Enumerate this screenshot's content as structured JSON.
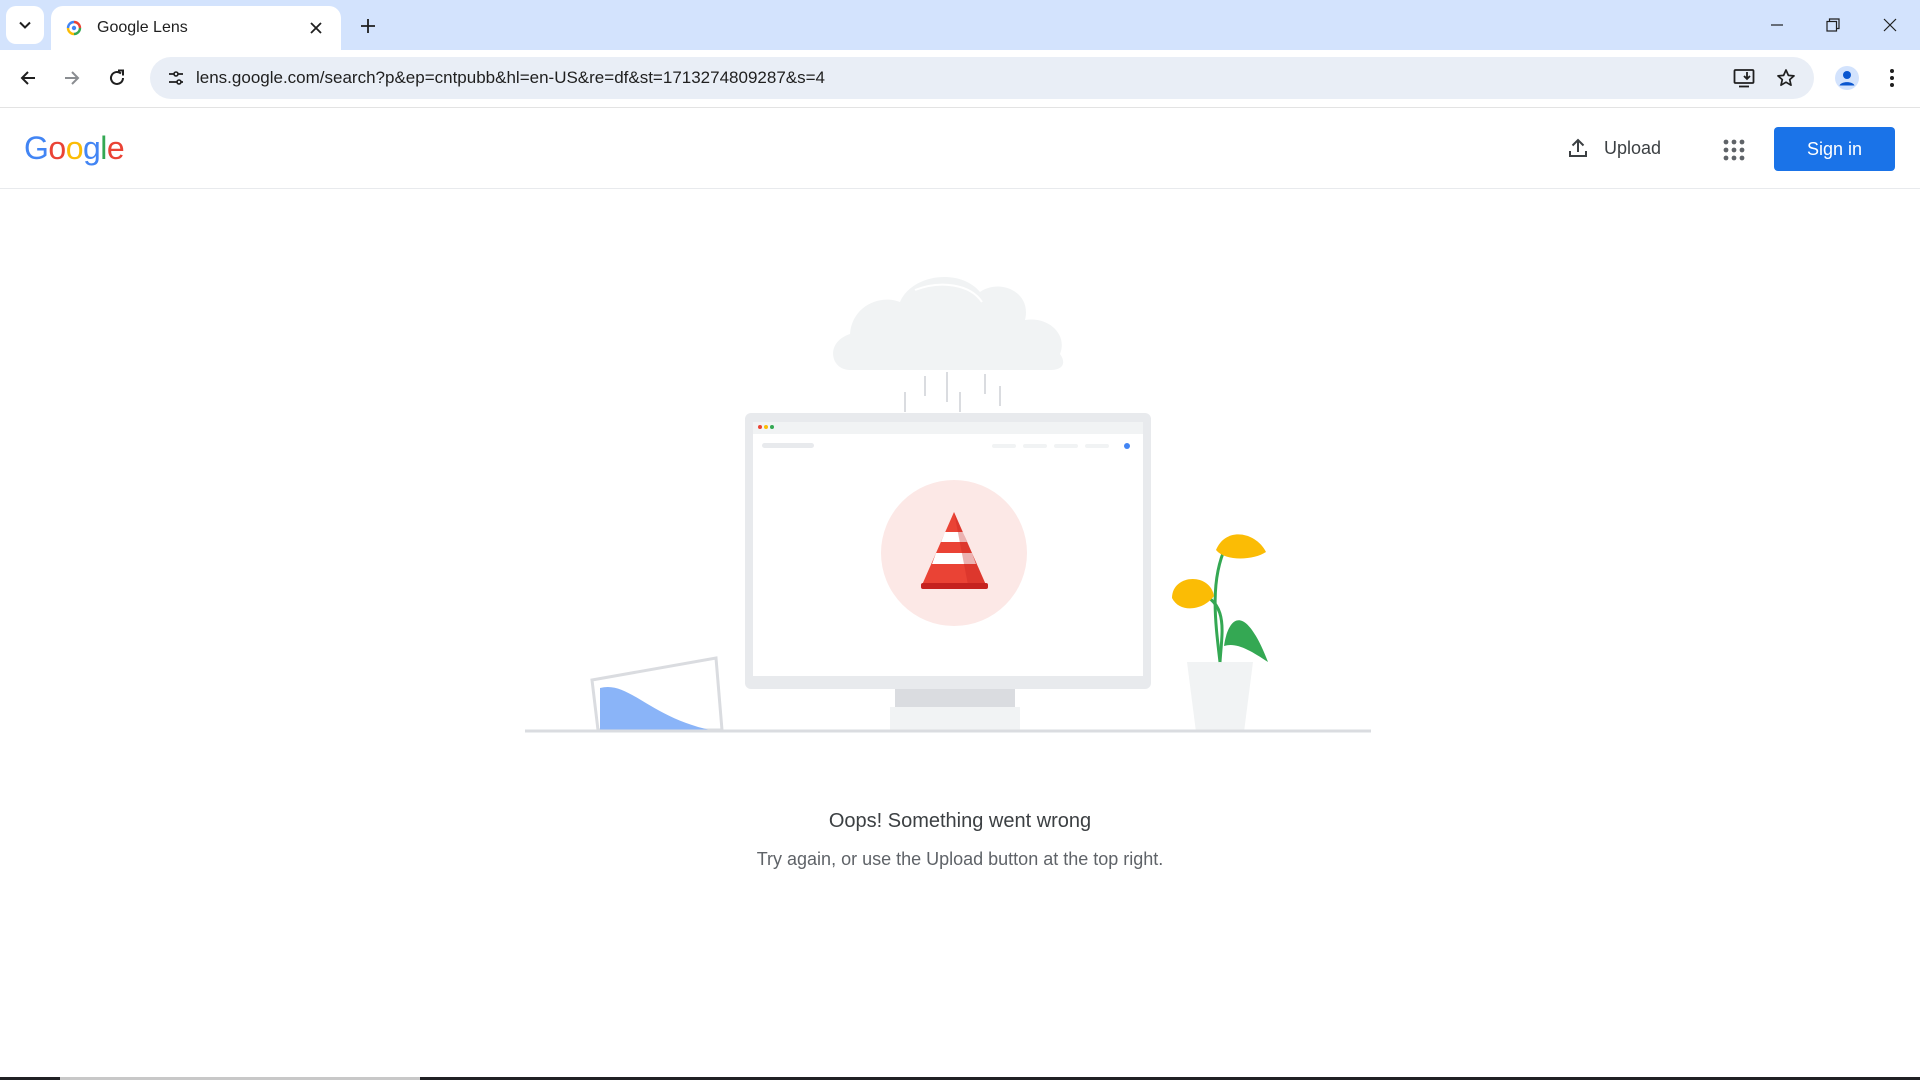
{
  "browser": {
    "tab_title": "Google Lens",
    "url": "lens.google.com/search?p&ep=cntpubb&hl=en-US&re=df&st=1713274809287&s=4"
  },
  "header": {
    "logo_letters": [
      "G",
      "o",
      "o",
      "g",
      "l",
      "e"
    ],
    "logo_colors": [
      "#4285f4",
      "#ea4335",
      "#fbbc05",
      "#4285f4",
      "#34a853",
      "#ea4335"
    ],
    "upload_label": "Upload",
    "signin_label": "Sign in"
  },
  "error": {
    "title": "Oops! Something went wrong",
    "message": "Try again, or use the Upload button at the top right."
  },
  "colors": {
    "accent": "#1a73e8",
    "tabstrip": "#d3e3fd",
    "omnibox": "#e9eef6"
  },
  "icons": {
    "tab_search": "chevron-down-icon",
    "favicon": "google-lens-icon",
    "tab_close": "close-icon",
    "new_tab": "plus-icon",
    "back": "arrow-left-icon",
    "forward": "arrow-right-icon",
    "reload": "reload-icon",
    "site_info": "tune-icon",
    "install": "install-app-icon",
    "bookmark": "star-icon",
    "profile": "person-icon",
    "menu": "kebab-menu-icon",
    "upload": "upload-icon",
    "apps": "apps-grid-icon"
  }
}
